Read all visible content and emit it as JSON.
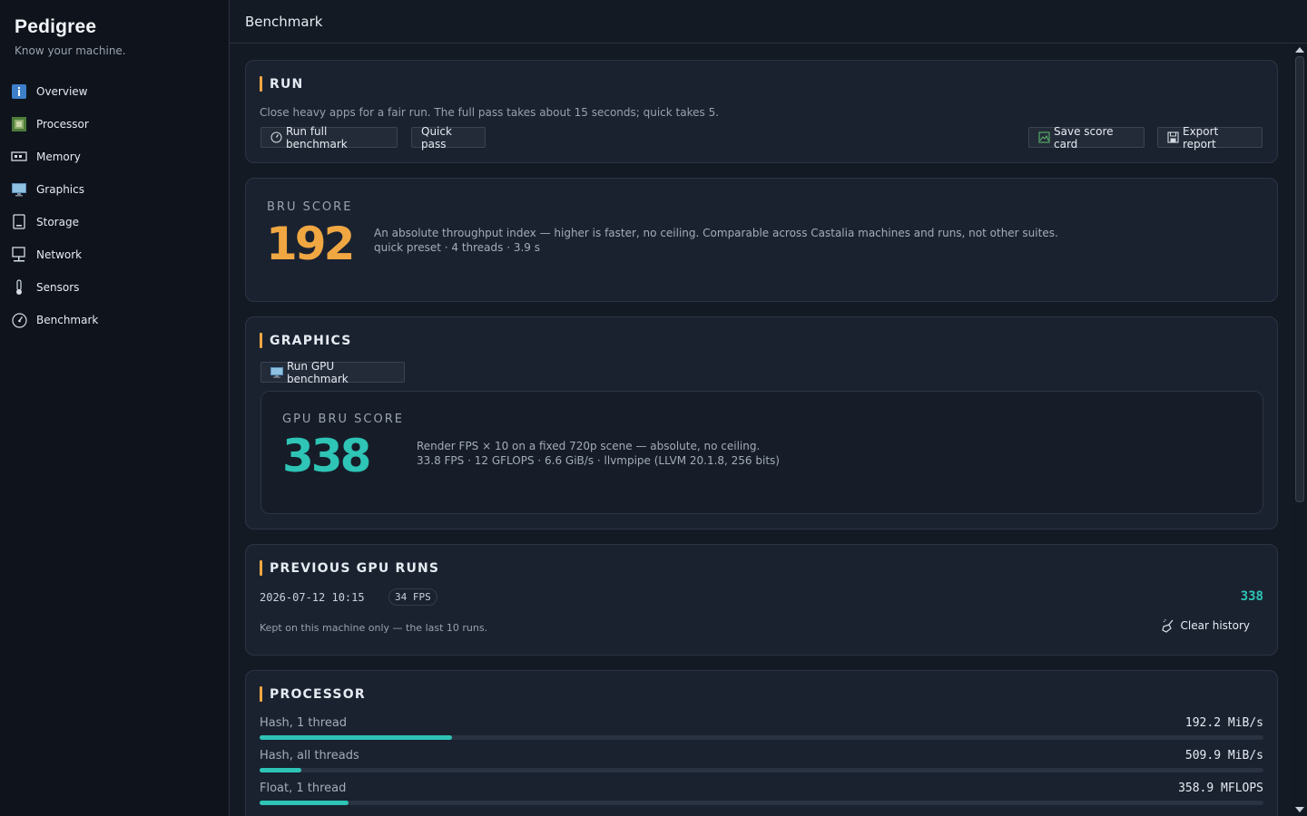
{
  "app": {
    "name": "Pedigree",
    "tagline": "Know your machine."
  },
  "sidebar": {
    "items": [
      {
        "label": "Overview",
        "icon": "info-icon"
      },
      {
        "label": "Processor",
        "icon": "chip-icon"
      },
      {
        "label": "Memory",
        "icon": "memory-icon"
      },
      {
        "label": "Graphics",
        "icon": "monitor-icon"
      },
      {
        "label": "Storage",
        "icon": "storage-icon"
      },
      {
        "label": "Network",
        "icon": "network-icon"
      },
      {
        "label": "Sensors",
        "icon": "thermometer-icon"
      },
      {
        "label": "Benchmark",
        "icon": "gauge-icon"
      }
    ]
  },
  "header": {
    "title": "Benchmark"
  },
  "run": {
    "title": "RUN",
    "description": "Close heavy apps for a fair run. The full pass takes about 15 seconds; quick takes 5.",
    "run_full_label": "Run full benchmark",
    "quick_pass_label": "Quick pass",
    "save_card_label": "Save score card",
    "export_label": "Export report"
  },
  "bru": {
    "label": "BRU SCORE",
    "score": "192",
    "description": "An absolute throughput index — higher is faster, no ceiling. Comparable across Castalia machines and runs, not other suites.",
    "details": "quick preset · 4 threads · 3.9 s"
  },
  "graphics": {
    "title": "GRAPHICS",
    "run_gpu_label": "Run GPU benchmark",
    "score_label": "GPU BRU SCORE",
    "score": "338",
    "description": "Render FPS × 10 on a fixed 720p scene — absolute, no ceiling.",
    "details": "33.8 FPS · 12 GFLOPS · 6.6 GiB/s · llvmpipe (LLVM 20.1.8, 256 bits)"
  },
  "previous_runs": {
    "title": "PREVIOUS GPU RUNS",
    "runs": [
      {
        "date": "2026-07-12 10:15",
        "fps": "34 FPS",
        "score": "338"
      }
    ],
    "note": "Kept on this machine only — the last 10 runs.",
    "clear_label": "Clear history"
  },
  "processor": {
    "title": "PROCESSOR",
    "metrics": [
      {
        "label": "Hash, 1 thread",
        "value": "192.2 MiB/s",
        "fraction": 0.192
      },
      {
        "label": "Hash, all threads",
        "value": "509.9 MiB/s",
        "fraction": 0.042
      },
      {
        "label": "Float, 1 thread",
        "value": "358.9 MFLOPS",
        "fraction": 0.089
      }
    ]
  },
  "colors": {
    "accent_orange": "#f0a742",
    "accent_teal": "#2ec4b6",
    "background": "#141a24"
  }
}
